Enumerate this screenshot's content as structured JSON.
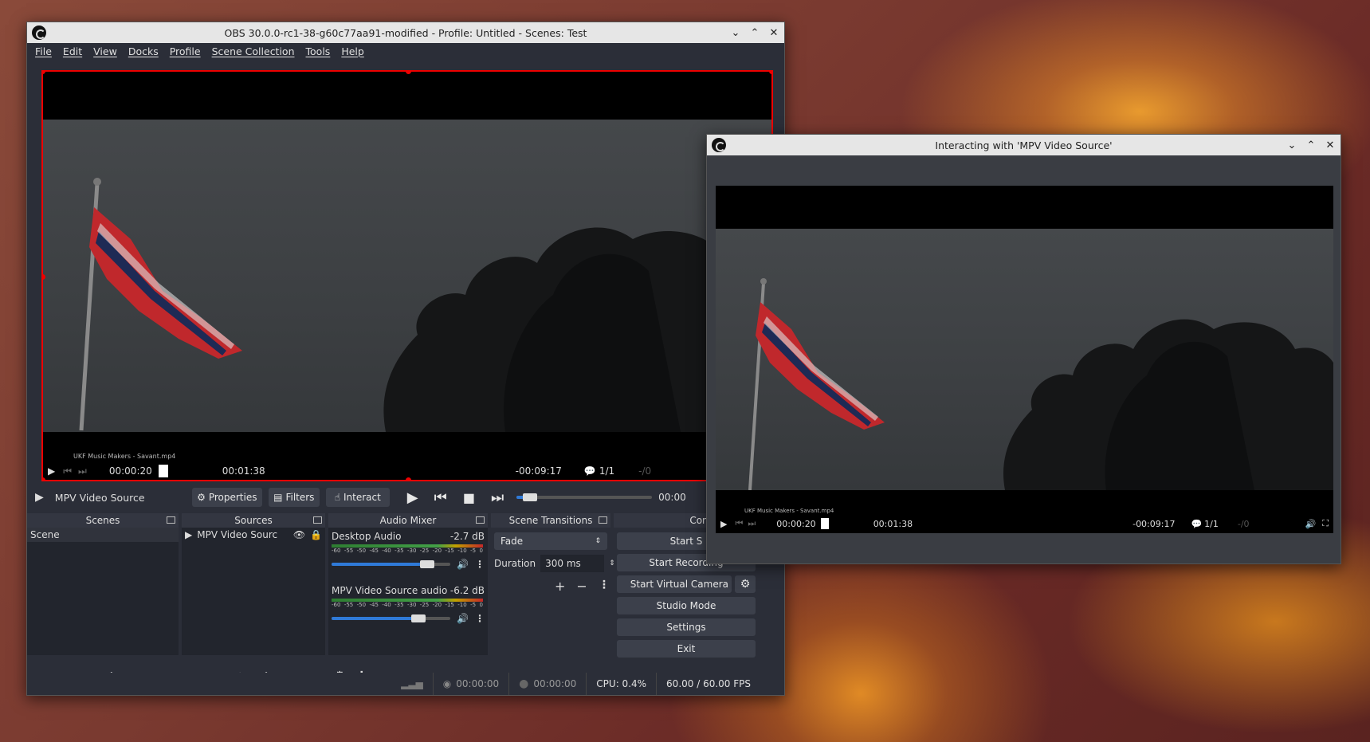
{
  "main_window": {
    "title": "OBS 30.0.0-rc1-38-g60c77aa91-modified - Profile: Untitled - Scenes: Test",
    "menu": [
      "File",
      "Edit",
      "View",
      "Docks",
      "Profile",
      "Scene Collection",
      "Tools",
      "Help"
    ]
  },
  "preview_osd": {
    "filename": "UKF Music Makers - Savant.mp4",
    "time_current": "00:00:20",
    "time_total": "00:01:38",
    "time_remaining": "-00:09:17",
    "subtitle_count": "1/1",
    "extra": "-/0"
  },
  "source_toolbar": {
    "source_name": "MPV Video Source",
    "properties_label": "Properties",
    "filters_label": "Filters",
    "interact_label": "Interact",
    "time_label": "00:00",
    "seek_progress": 0.07
  },
  "docks": {
    "scenes": {
      "title": "Scenes",
      "items": [
        "Scene"
      ]
    },
    "sources": {
      "title": "Sources",
      "items": [
        "MPV Video Sourc"
      ]
    },
    "audio_mixer": {
      "title": "Audio Mixer",
      "channels": [
        {
          "name": "Desktop Audio",
          "db": "-2.7 dB",
          "level": 0.77
        },
        {
          "name": "MPV Video Source audio",
          "db": "-6.2 dB",
          "level": 0.7
        }
      ],
      "ticks": [
        "-60",
        "-55",
        "-50",
        "-45",
        "-40",
        "-35",
        "-30",
        "-25",
        "-20",
        "-15",
        "-10",
        "-5",
        "0"
      ]
    },
    "scene_transitions": {
      "title": "Scene Transitions",
      "transition": "Fade",
      "duration_label": "Duration",
      "duration_value": "300 ms"
    },
    "controls": {
      "title": "Con",
      "buttons": [
        "Start S",
        "Start Recording",
        "Start Virtual Camera",
        "Studio Mode",
        "Settings",
        "Exit"
      ]
    }
  },
  "status_bar": {
    "stream_time": "00:00:00",
    "rec_time": "00:00:00",
    "cpu": "CPU: 0.4%",
    "fps": "60.00 / 60.00 FPS"
  },
  "interact_window": {
    "title": "Interacting with 'MPV Video Source'",
    "filename": "UKF Music Makers - Savant.mp4",
    "time_current": "00:00:20",
    "time_total": "00:01:38",
    "time_remaining": "-00:09:17",
    "subtitle_count": "1/1",
    "extra": "-/0"
  }
}
